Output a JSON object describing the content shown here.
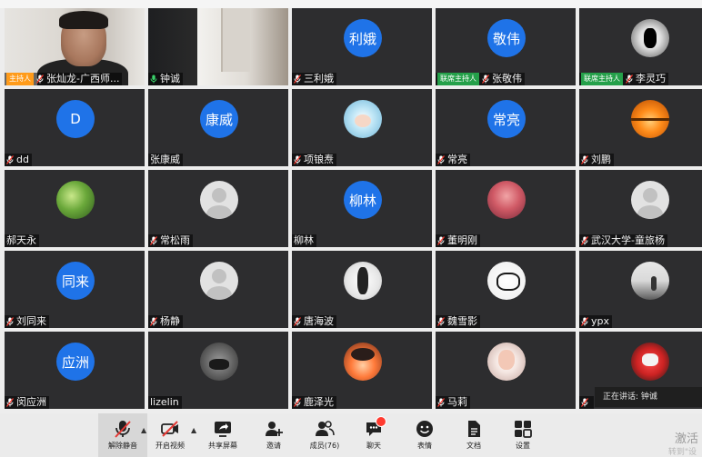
{
  "colors": {
    "host_badge": "#ff9b1a",
    "cohost_badge": "#25a04a",
    "avatar_blue": "#1f73e8",
    "tile_bg": "#2d2d2f"
  },
  "participants": [
    {
      "name": "张灿龙-广西师...",
      "badge": "主持人",
      "badge_type": "host",
      "mic": "muted",
      "avatar": "video-host"
    },
    {
      "name": "钟诚",
      "badge": "",
      "badge_type": "",
      "mic": "active",
      "avatar": "video-2"
    },
    {
      "name": "三利娥",
      "badge": "",
      "badge_type": "",
      "mic": "muted",
      "avatar": "circle",
      "initials": "利娥"
    },
    {
      "name": "张敬伟",
      "badge": "联席主持人",
      "badge_type": "cohost",
      "mic": "muted",
      "avatar": "circle",
      "initials": "敬伟"
    },
    {
      "name": "李灵巧",
      "badge": "联席主持人",
      "badge_type": "cohost",
      "mic": "muted",
      "avatar": "dark"
    },
    {
      "name": "dd",
      "badge": "",
      "badge_type": "",
      "mic": "muted",
      "avatar": "circle",
      "initials": "D"
    },
    {
      "name": "张康威",
      "badge": "",
      "badge_type": "",
      "mic": "none",
      "avatar": "circle",
      "initials": "康威"
    },
    {
      "name": "项锒焘",
      "badge": "",
      "badge_type": "",
      "mic": "muted",
      "avatar": "anime"
    },
    {
      "name": "常亮",
      "badge": "",
      "badge_type": "",
      "mic": "muted",
      "avatar": "circle",
      "initials": "常亮"
    },
    {
      "name": "刘鹏",
      "badge": "",
      "badge_type": "",
      "mic": "muted",
      "avatar": "sunset"
    },
    {
      "name": "郝天永",
      "badge": "",
      "badge_type": "",
      "mic": "none",
      "avatar": "leaf"
    },
    {
      "name": "常松雨",
      "badge": "",
      "badge_type": "",
      "mic": "muted",
      "avatar": "grey"
    },
    {
      "name": "柳林",
      "badge": "",
      "badge_type": "",
      "mic": "none",
      "avatar": "circle",
      "initials": "柳林"
    },
    {
      "name": "董明刚",
      "badge": "",
      "badge_type": "",
      "mic": "muted",
      "avatar": "tree"
    },
    {
      "name": "武汉大学-童旅杨",
      "badge": "",
      "badge_type": "",
      "mic": "muted",
      "avatar": "grey"
    },
    {
      "name": "刘同来",
      "badge": "",
      "badge_type": "",
      "mic": "muted",
      "avatar": "circle",
      "initials": "同来"
    },
    {
      "name": "杨静",
      "badge": "",
      "badge_type": "",
      "mic": "muted",
      "avatar": "grey"
    },
    {
      "name": "唐海波",
      "badge": "",
      "badge_type": "",
      "mic": "muted",
      "avatar": "sketch"
    },
    {
      "name": "魏雪影",
      "badge": "",
      "badge_type": "",
      "mic": "muted",
      "avatar": "calli"
    },
    {
      "name": "ypx",
      "badge": "",
      "badge_type": "",
      "mic": "muted",
      "avatar": "landscape"
    },
    {
      "name": "闵应洲",
      "badge": "",
      "badge_type": "",
      "mic": "muted",
      "avatar": "circle",
      "initials": "应洲"
    },
    {
      "name": "lizelin",
      "badge": "",
      "badge_type": "",
      "mic": "none",
      "avatar": "bw"
    },
    {
      "name": "鹿泽光",
      "badge": "",
      "badge_type": "",
      "mic": "muted",
      "avatar": "flame"
    },
    {
      "name": "马莉",
      "badge": "",
      "badge_type": "",
      "mic": "muted",
      "avatar": "girl"
    },
    {
      "name": "",
      "badge": "",
      "badge_type": "",
      "mic": "muted",
      "avatar": "red"
    }
  ],
  "speaking_toast": "正在讲话: 钟诚",
  "toolbar": {
    "unmute": "解除静音",
    "start_video": "开启视频",
    "share_screen": "共享屏幕",
    "invite": "邀请",
    "members": "成员(76)",
    "chat": "聊天",
    "reactions": "表情",
    "documents": "文档",
    "settings": "设置"
  },
  "watermark": "激活",
  "watermark_sub": "转到\"设"
}
